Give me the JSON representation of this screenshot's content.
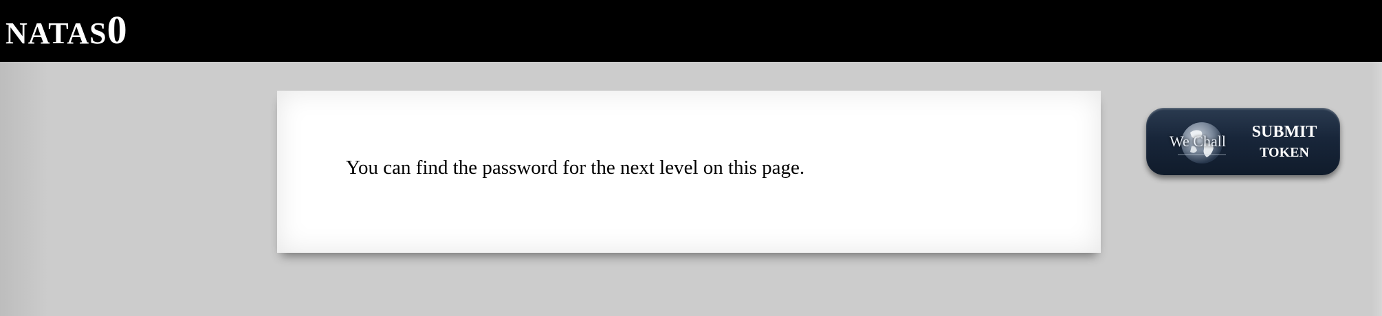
{
  "header": {
    "title_prefix": "NATAS",
    "title_level": "0"
  },
  "content": {
    "message": "You can find the password for the next level on this page."
  },
  "submit_button": {
    "brand": "We Chall",
    "label_line1": "Submit",
    "label_line2": "token",
    "icon": "globe-icon"
  },
  "colors": {
    "header_bg": "#000000",
    "page_bg": "#cccccc",
    "card_bg": "#ffffff",
    "button_bg": "#18263a"
  }
}
